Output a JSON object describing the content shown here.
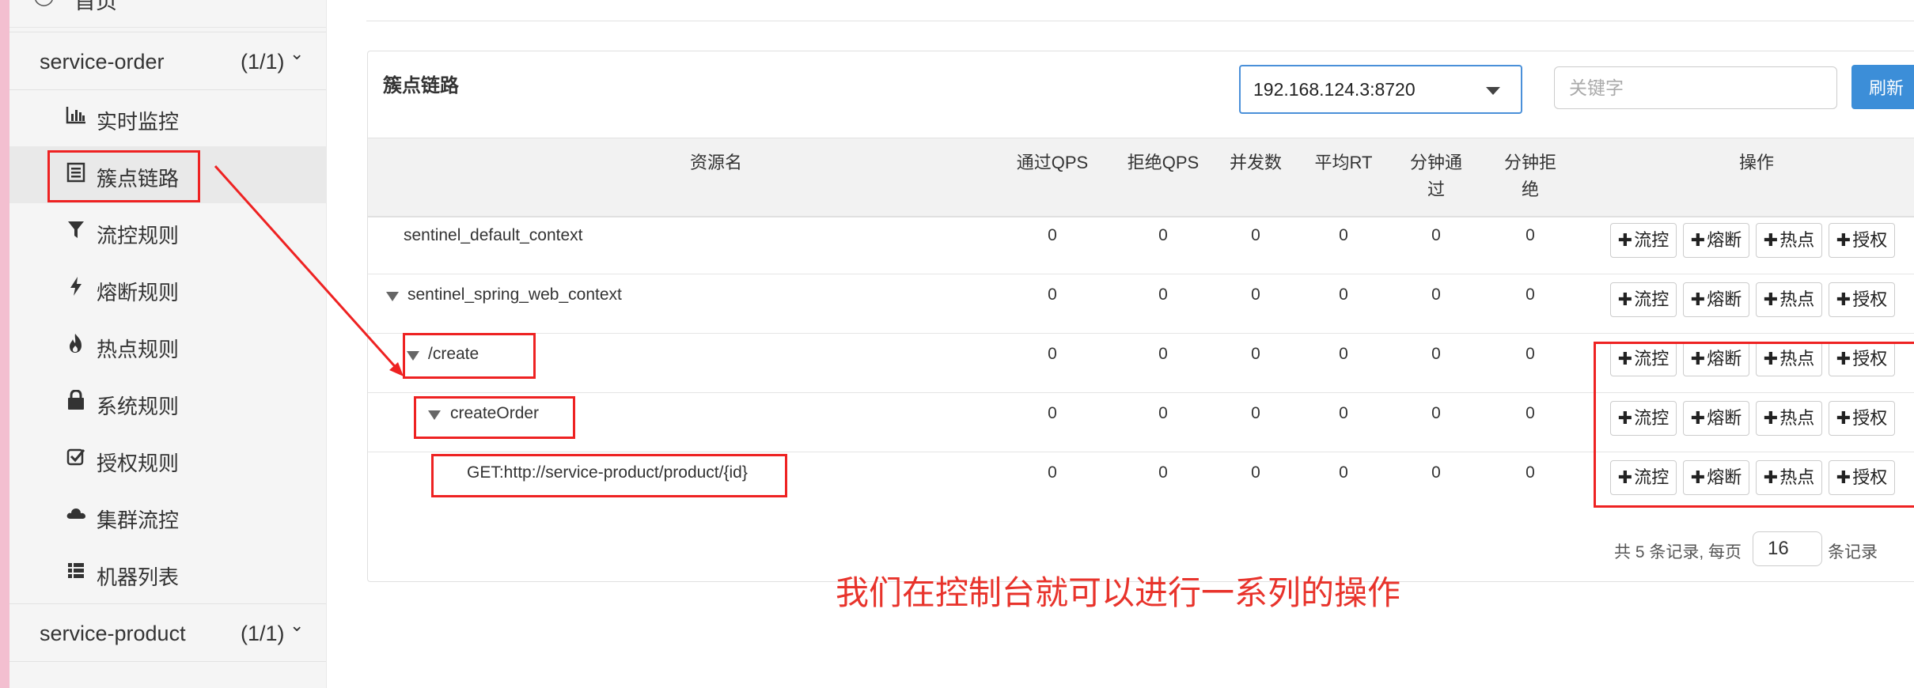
{
  "sidebar": {
    "home_label": "首页",
    "apps": [
      {
        "name": "service-order",
        "count": "(1/1)"
      },
      {
        "name": "service-product",
        "count": "(1/1)"
      }
    ],
    "menu": [
      {
        "label": "实时监控",
        "icon": "bar-chart-icon"
      },
      {
        "label": "簇点链路",
        "icon": "list-icon"
      },
      {
        "label": "流控规则",
        "icon": "filter-icon"
      },
      {
        "label": "熔断规则",
        "icon": "bolt-icon"
      },
      {
        "label": "热点规则",
        "icon": "fire-icon"
      },
      {
        "label": "系统规则",
        "icon": "lock-icon"
      },
      {
        "label": "授权规则",
        "icon": "check-icon"
      },
      {
        "label": "集群流控",
        "icon": "cloud-icon"
      },
      {
        "label": "机器列表",
        "icon": "th-list-icon"
      }
    ]
  },
  "panel": {
    "title": "簇点链路",
    "machine": "192.168.124.3:8720",
    "keyword_placeholder": "关键字",
    "refresh_label": "刷新"
  },
  "table": {
    "headers": {
      "resource": "资源名",
      "pass_qps": "通过QPS",
      "block_qps": "拒绝QPS",
      "threads": "并发数",
      "avg_rt": "平均RT",
      "minute_pass_1": "分钟通",
      "minute_pass_2": "过",
      "minute_block_1": "分钟拒",
      "minute_block_2": "绝",
      "ops": "操作"
    },
    "rows": [
      {
        "resource": "sentinel_default_context",
        "pass_qps": "0",
        "block_qps": "0",
        "threads": "0",
        "avg_rt": "0",
        "minute_pass": "0",
        "minute_block": "0"
      },
      {
        "resource": "sentinel_spring_web_context",
        "pass_qps": "0",
        "block_qps": "0",
        "threads": "0",
        "avg_rt": "0",
        "minute_pass": "0",
        "minute_block": "0"
      },
      {
        "resource": "/create",
        "pass_qps": "0",
        "block_qps": "0",
        "threads": "0",
        "avg_rt": "0",
        "minute_pass": "0",
        "minute_block": "0"
      },
      {
        "resource": "createOrder",
        "pass_qps": "0",
        "block_qps": "0",
        "threads": "0",
        "avg_rt": "0",
        "minute_pass": "0",
        "minute_block": "0"
      },
      {
        "resource": "GET:http://service-product/product/{id}",
        "pass_qps": "0",
        "block_qps": "0",
        "threads": "0",
        "avg_rt": "0",
        "minute_pass": "0",
        "minute_block": "0"
      }
    ],
    "op_buttons": {
      "flow": "流控",
      "degrade": "熔断",
      "hot": "热点",
      "auth": "授权"
    }
  },
  "pager": {
    "prefix": "共 5 条记录, 每页",
    "page_size": "16",
    "suffix": "条记录"
  },
  "annotation": "我们在控制台就可以进行一系列的操作",
  "colors": {
    "accent": "#3c8ed8",
    "annotation_red": "#e8332b"
  }
}
